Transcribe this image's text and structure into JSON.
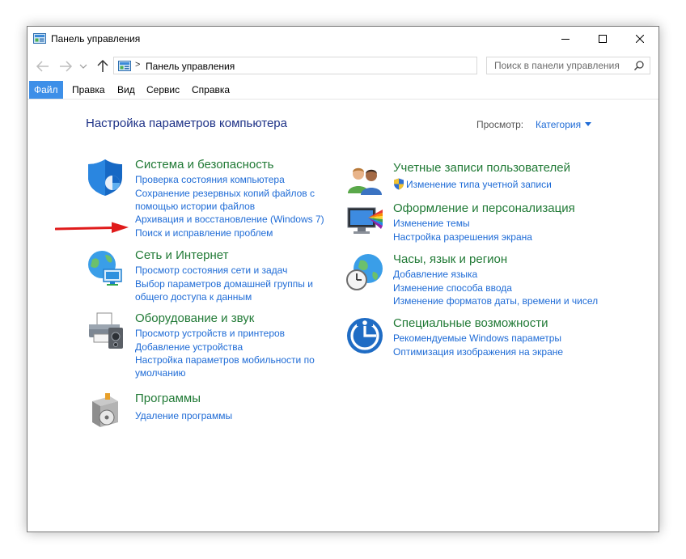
{
  "window": {
    "title": "Панель управления"
  },
  "address_bar": {
    "path": "Панель управления",
    "separator": ">"
  },
  "search": {
    "placeholder": "Поиск в панели управления"
  },
  "menu": {
    "file": "Файл",
    "edit": "Правка",
    "view": "Вид",
    "tools": "Сервис",
    "help": "Справка"
  },
  "content": {
    "heading": "Настройка параметров компьютера",
    "view_by_label": "Просмотр:",
    "view_by_value": "Категория"
  },
  "categories": {
    "system": {
      "title": "Система и безопасность",
      "links": [
        "Проверка состояния компьютера",
        "Сохранение резервных копий файлов с",
        "помощью истории файлов",
        "Архивация и восстановление (Windows 7)",
        "Поиск и исправление проблем"
      ]
    },
    "network": {
      "title": "Сеть и Интернет",
      "links": [
        "Просмотр состояния сети и задач",
        "Выбор параметров домашней группы и",
        "общего доступа к данным"
      ]
    },
    "hardware": {
      "title": "Оборудование и звук",
      "links": [
        "Просмотр устройств и принтеров",
        "Добавление устройства",
        "Настройка параметров мобильности по",
        "умолчанию"
      ]
    },
    "programs": {
      "title": "Программы",
      "links": [
        "Удаление программы"
      ]
    },
    "accounts": {
      "title": "Учетные записи пользователей",
      "links": [
        "Изменение типа учетной записи"
      ]
    },
    "appearance": {
      "title": "Оформление и персонализация",
      "links": [
        "Изменение темы",
        "Настройка разрешения экрана"
      ]
    },
    "clock": {
      "title": "Часы, язык и регион",
      "links": [
        "Добавление языка",
        "Изменение способа ввода",
        "Изменение форматов даты, времени и чисел"
      ]
    },
    "access": {
      "title": "Специальные возможности",
      "links": [
        "Рекомендуемые Windows параметры",
        "Оптимизация изображения на экране"
      ]
    }
  },
  "colors": {
    "category_title": "#217a36",
    "link": "#1e6bd6",
    "heading": "#1e3287",
    "menu_active": "#3d8fe8",
    "annotation_arrow": "#e01b1b"
  }
}
